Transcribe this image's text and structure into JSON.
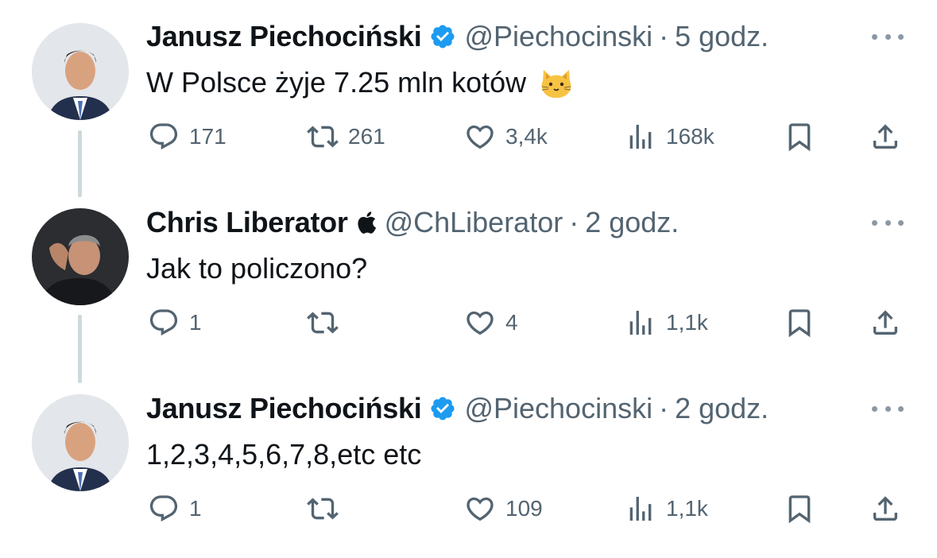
{
  "colors": {
    "verified": "#1d9bf0",
    "secondary_text": "#536471",
    "thread_line": "#cfd9de"
  },
  "tweets": [
    {
      "author_name": "Janusz Piechociński",
      "badge": "verified-badge-icon",
      "handle": "@Piechocinski",
      "separator": "·",
      "time": "5 godz.",
      "text": "W Polsce żyje 7.25 mln kotów",
      "emoji": "cat-face-emoji",
      "stats": {
        "replies": "171",
        "retweets": "261",
        "likes": "3,4k",
        "views": "168k"
      }
    },
    {
      "author_name": "Chris Liberator",
      "badge": "apple-logo-icon",
      "handle": "@ChLiberator",
      "separator": "·",
      "time": "2 godz.",
      "text": "Jak to policzono?",
      "stats": {
        "replies": "1",
        "retweets": "",
        "likes": "4",
        "views": "1,1k"
      }
    },
    {
      "author_name": "Janusz Piechociński",
      "badge": "verified-badge-icon",
      "handle": "@Piechocinski",
      "separator": "·",
      "time": "2 godz.",
      "text": "1,2,3,4,5,6,7,8,etc etc",
      "stats": {
        "replies": "1",
        "retweets": "",
        "likes": "109",
        "views": "1,1k"
      }
    }
  ]
}
